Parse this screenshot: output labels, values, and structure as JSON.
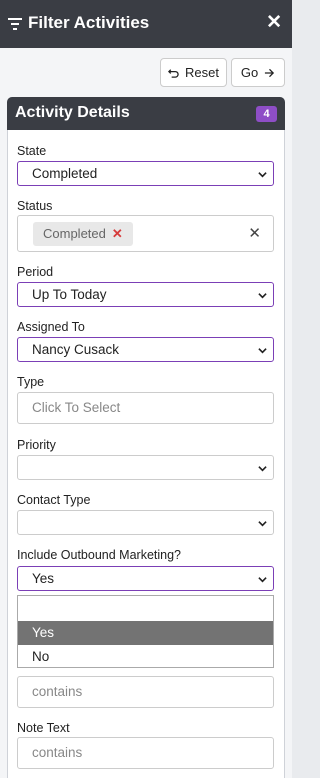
{
  "header": {
    "title": "Filter Activities",
    "close_label": "✕"
  },
  "toolbar": {
    "reset_label": "Reset",
    "go_label": "Go"
  },
  "section": {
    "title": "Activity Details",
    "badge": "4"
  },
  "fields": {
    "state": {
      "label": "State",
      "value": "Completed"
    },
    "status": {
      "label": "Status",
      "chip": "Completed",
      "chip_remove": "✕",
      "clear": "✕"
    },
    "period": {
      "label": "Period",
      "value": "Up To Today"
    },
    "assigned_to": {
      "label": "Assigned To",
      "value": "Nancy Cusack"
    },
    "type": {
      "label": "Type",
      "placeholder": "Click To Select"
    },
    "priority": {
      "label": "Priority",
      "value": ""
    },
    "contact_type": {
      "label": "Contact Type",
      "value": ""
    },
    "outbound": {
      "label": "Include Outbound Marketing?",
      "value": "Yes",
      "options": [
        "",
        "Yes",
        "No"
      ]
    },
    "subject": {
      "placeholder": "contains"
    },
    "note_text": {
      "label": "Note Text",
      "placeholder": "contains"
    }
  },
  "colors": {
    "header_bg": "#3a3d44",
    "accent": "#7b3fb6",
    "badge": "#8e4ec6",
    "highlight": "#737373",
    "chip_x": "#d63b3b"
  }
}
